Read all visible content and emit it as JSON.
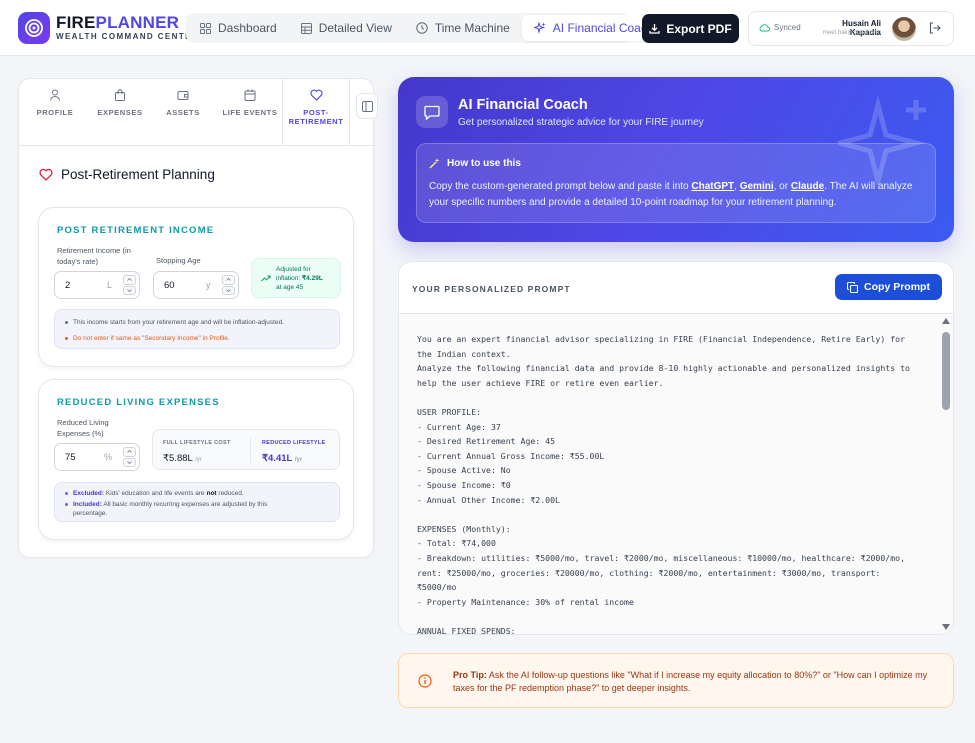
{
  "brand": {
    "name_part1": "FIRE",
    "name_part2": "PLANNER",
    "subtitle": "WEALTH COMMAND CENTER"
  },
  "nav": {
    "tabs": [
      {
        "label": "Dashboard",
        "icon": "grid-icon"
      },
      {
        "label": "Detailed View",
        "icon": "table-icon"
      },
      {
        "label": "Time Machine",
        "icon": "clock-icon"
      },
      {
        "label": "AI Financial Coach",
        "icon": "sparkles-icon",
        "active": true
      }
    ]
  },
  "header": {
    "export_label": "Export PDF",
    "sync_status": "Synced",
    "user_name": "Husain Ali Kapadia",
    "user_email": "meet.hak@gmail.com"
  },
  "left_tabs": [
    {
      "label": "PROFILE",
      "icon": "user-icon"
    },
    {
      "label": "EXPENSES",
      "icon": "bag-icon"
    },
    {
      "label": "ASSETS",
      "icon": "wallet-icon"
    },
    {
      "label": "LIFE EVENTS",
      "icon": "calendar-icon"
    },
    {
      "label": "POST-",
      "label2": "RETIREMENT",
      "icon": "heart-icon",
      "active": true
    }
  ],
  "section": {
    "title": "Post-Retirement Planning"
  },
  "income_card": {
    "title": "POST RETIREMENT INCOME",
    "income_label_1": "Retirement Income (in",
    "income_label_2": "today's rate)",
    "income_value": "2",
    "income_unit": "L",
    "age_label": "Stopping Age",
    "age_value": "60",
    "age_unit": "y",
    "adjusted_line1": "Adjusted for",
    "adjusted_line2_prefix": "inflation: ",
    "adjusted_amount": "₹4.29L",
    "adjusted_line3": "at age 45",
    "note1": "This income starts from your retirement age and will be inflation-adjusted.",
    "note2": "Do not enter if same as \"Secondary Income\" in Profile."
  },
  "expenses_card": {
    "title": "REDUCED LIVING EXPENSES",
    "label_1": "Reduced Living",
    "label_2": "Expenses (%)",
    "value": "75",
    "unit": "%",
    "full_label": "FULL LIFESTYLE COST",
    "full_value": "₹5.88L",
    "per_yr": "/yr",
    "reduced_label": "REDUCED LIFESTYLE",
    "reduced_value": "₹4.41L",
    "excluded_bold": "Excluded:",
    "excluded_text": " Kids' education and life events are ",
    "excluded_not": "not",
    "excluded_end": " reduced.",
    "included_bold": "Included:",
    "included_text": " All basic monthly recurring expenses are adjusted by this",
    "included_text2": "percentage."
  },
  "coach": {
    "title": "AI Financial Coach",
    "subtitle": "Get personalized strategic advice for your FIRE journey",
    "howto_title": "How to use this",
    "howto_text_1": "Copy the custom-generated prompt below and paste it into ",
    "link_chatgpt": "ChatGPT",
    "sep1": ", ",
    "link_gemini": "Gemini",
    "sep2": ", or ",
    "link_claude": "Claude",
    "howto_text_2": ". The AI will analyze your specific numbers and provide a detailed 10-point roadmap for your retirement planning."
  },
  "prompt": {
    "label": "YOUR PERSONALIZED PROMPT",
    "copy_label": "Copy Prompt",
    "text": "You are an expert financial advisor specializing in FIRE (Financial Independence, Retire Early) for\nthe Indian context.\nAnalyze the following financial data and provide 8-10 highly actionable and personalized insights to\nhelp the user achieve FIRE or retire even earlier.\n\nUSER PROFILE:\n- Current Age: 37\n- Desired Retirement Age: 45\n- Current Annual Gross Income: ₹55.00L\n- Spouse Active: No\n- Spouse Income: ₹0\n- Annual Other Income: ₹2.00L\n\nEXPENSES (Monthly):\n- Total: ₹74,000\n- Breakdown: utilities: ₹5000/mo, travel: ₹2000/mo, miscellaneous: ₹10000/mo, healthcare: ₹2000/mo,\nrent: ₹25000/mo, groceries: ₹20000/mo, clothing: ₹2000/mo, entertainment: ₹3000/mo, transport:\n₹5000/mo\n- Property Maintenance: 30% of rental income\n\nANNUAL FIXED SPENDS:"
  },
  "tip": {
    "bold": "Pro Tip:",
    "text": " Ask the AI follow-up questions like \"What if I increase my equity allocation to 80%?\" or \"How can I optimize my taxes for the PF redemption phase?\" to get deeper insights."
  },
  "colors": {
    "accent": "#4f46e5",
    "teal": "#0e9aa7",
    "copy_button": "#1d4ed8",
    "tip_bg": "#fff7ed"
  }
}
